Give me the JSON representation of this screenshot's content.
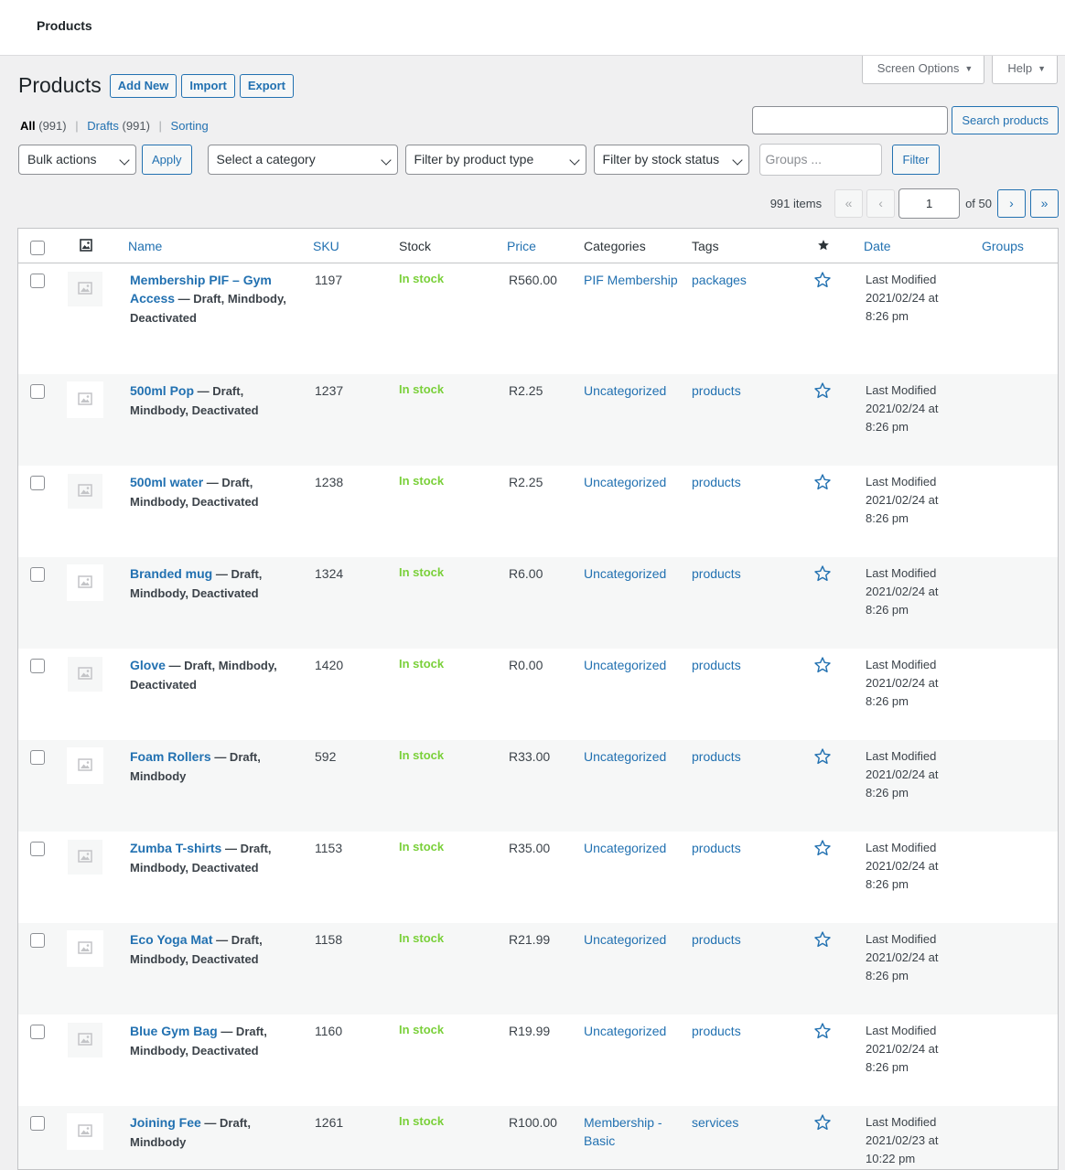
{
  "topbar": {
    "title": "Products"
  },
  "screen_tabs": {
    "screen_options": "Screen Options",
    "help": "Help"
  },
  "heading": {
    "title": "Products",
    "add_new": "Add New",
    "import": "Import",
    "export": "Export"
  },
  "views": {
    "all": "All",
    "all_count": "(991)",
    "drafts": "Drafts",
    "drafts_count": "(991)",
    "sorting": "Sorting",
    "sep": "|"
  },
  "search": {
    "value": "",
    "button": "Search products"
  },
  "filters": {
    "bulk_actions": "Bulk actions",
    "apply": "Apply",
    "category": "Select a category",
    "product_type": "Filter by product type",
    "stock_status": "Filter by stock status",
    "groups_placeholder": "Groups ...",
    "filter": "Filter"
  },
  "pagination": {
    "items": "991 items",
    "first": "«",
    "prev": "‹",
    "current": "1",
    "of_label": "of 50",
    "next": "›",
    "last": "»"
  },
  "columns": {
    "name": "Name",
    "sku": "SKU",
    "stock": "Stock",
    "price": "Price",
    "categories": "Categories",
    "tags": "Tags",
    "date": "Date",
    "groups": "Groups"
  },
  "rows": [
    {
      "name": "Membership PIF – Gym Access",
      "status": " — Draft, Mindbody, Deactivated",
      "sku": "1197",
      "stock": "In stock",
      "price": "R560.00",
      "category": "PIF Membership",
      "tag": "packages",
      "date1": "Last Modified",
      "date2": "2021/02/24 at",
      "date3": "8:26 pm"
    },
    {
      "name": "500ml Pop",
      "status": " — Draft, Mindbody, Deactivated",
      "sku": "1237",
      "stock": "In stock",
      "price": "R2.25",
      "category": "Uncategorized",
      "tag": "products",
      "date1": "Last Modified",
      "date2": "2021/02/24 at",
      "date3": "8:26 pm"
    },
    {
      "name": "500ml water",
      "status": " — Draft, Mindbody, Deactivated",
      "sku": "1238",
      "stock": "In stock",
      "price": "R2.25",
      "category": "Uncategorized",
      "tag": "products",
      "date1": "Last Modified",
      "date2": "2021/02/24 at",
      "date3": "8:26 pm"
    },
    {
      "name": "Branded mug",
      "status": " — Draft, Mindbody, Deactivated",
      "sku": "1324",
      "stock": "In stock",
      "price": "R6.00",
      "category": "Uncategorized",
      "tag": "products",
      "date1": "Last Modified",
      "date2": "2021/02/24 at",
      "date3": "8:26 pm"
    },
    {
      "name": "Glove",
      "status": " — Draft, Mindbody, Deactivated",
      "sku": "1420",
      "stock": "In stock",
      "price": "R0.00",
      "category": "Uncategorized",
      "tag": "products",
      "date1": "Last Modified",
      "date2": "2021/02/24 at",
      "date3": "8:26 pm"
    },
    {
      "name": "Foam Rollers",
      "status": " — Draft, Mindbody",
      "sku": "592",
      "stock": "In stock",
      "price": "R33.00",
      "category": "Uncategorized",
      "tag": "products",
      "date1": "Last Modified",
      "date2": "2021/02/24 at",
      "date3": "8:26 pm"
    },
    {
      "name": "Zumba T-shirts",
      "status": " — Draft, Mindbody, Deactivated",
      "sku": "1153",
      "stock": "In stock",
      "price": "R35.00",
      "category": "Uncategorized",
      "tag": "products",
      "date1": "Last Modified",
      "date2": "2021/02/24 at",
      "date3": "8:26 pm"
    },
    {
      "name": "Eco Yoga Mat",
      "status": " — Draft, Mindbody, Deactivated",
      "sku": "1158",
      "stock": "In stock",
      "price": "R21.99",
      "category": "Uncategorized",
      "tag": "products",
      "date1": "Last Modified",
      "date2": "2021/02/24 at",
      "date3": "8:26 pm"
    },
    {
      "name": "Blue Gym Bag",
      "status": " — Draft, Mindbody, Deactivated",
      "sku": "1160",
      "stock": "In stock",
      "price": "R19.99",
      "category": "Uncategorized",
      "tag": "products",
      "date1": "Last Modified",
      "date2": "2021/02/24 at",
      "date3": "8:26 pm"
    },
    {
      "name": "Joining Fee",
      "status": " — Draft, Mindbody",
      "sku": "1261",
      "stock": "In stock",
      "price": "R100.00",
      "category": "Membership - Basic",
      "tag": "services",
      "date1": "Last Modified",
      "date2": "2021/02/23 at",
      "date3": "10:22 pm"
    }
  ]
}
